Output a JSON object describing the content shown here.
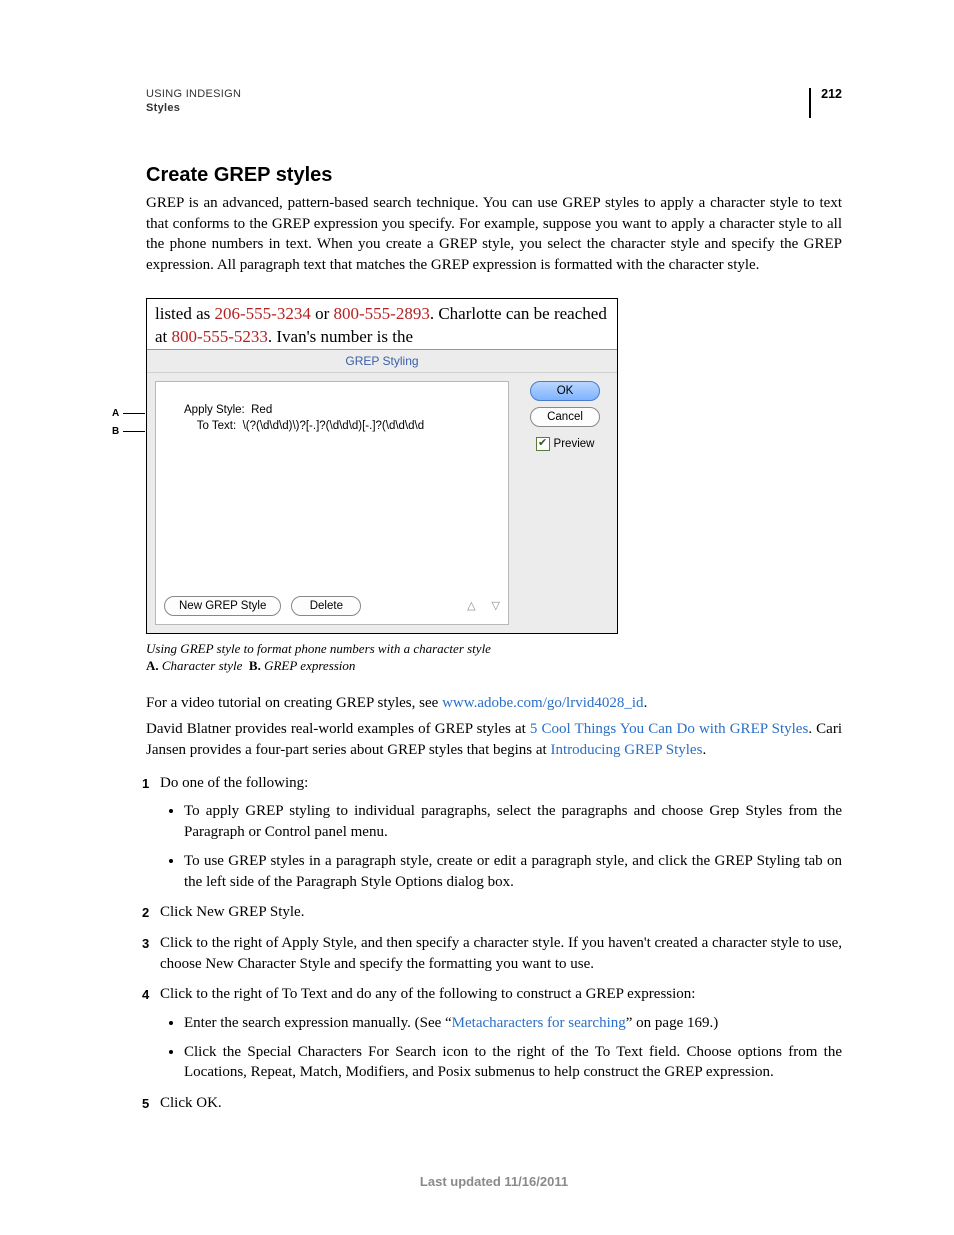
{
  "header": {
    "product": "USING INDESIGN",
    "section": "Styles",
    "page_number": "212"
  },
  "title": "Create GREP styles",
  "intro": "GREP is an advanced, pattern-based search technique. You can use GREP styles to apply a character style to text that conforms to the GREP expression you specify. For example, suppose you want to apply a character style to all the phone numbers in text. When you create a GREP style, you select the character style and specify the GREP expression. All paragraph text that matches the GREP expression is formatted with the character style.",
  "figure": {
    "sample": {
      "prefix1": "listed as ",
      "phone1": "206-555-3234",
      "mid1": " or ",
      "phone2": "800-555-2893",
      "suffix1": ". Charlotte can be reached at ",
      "phone3": "800-555-5233",
      "suffix2": ". Ivan's number is the"
    },
    "dialog_title": "GREP Styling",
    "apply_style_label": "Apply Style:",
    "apply_style_value": "Red",
    "to_text_label": "To Text:",
    "to_text_value": "\\(?(\\d\\d\\d)\\)?[-.]?(\\d\\d\\d)[-.]?(\\d\\d\\d\\d",
    "ok": "OK",
    "cancel": "Cancel",
    "preview": "Preview",
    "new_grep_style": "New GREP Style",
    "delete": "Delete",
    "callout_a": "A",
    "callout_b": "B",
    "caption_main": "Using GREP style to format phone numbers with a character style",
    "caption_a_label": "A.",
    "caption_a_text": "Character style",
    "caption_b_label": "B.",
    "caption_b_text": "GREP expression"
  },
  "para2": {
    "prefix": "For a video tutorial on creating GREP styles, see ",
    "link": "www.adobe.com/go/lrvid4028_id",
    "suffix": "."
  },
  "para3": {
    "p1": "David Blatner provides real-world examples of GREP styles at ",
    "link1": "5 Cool Things You Can Do with GREP Styles",
    "p2": ". Cari Jansen provides a four-part series about GREP styles that begins at ",
    "link2": "Introducing GREP Styles",
    "p3": "."
  },
  "steps": {
    "s1": "Do one of the following:",
    "s1_b1": "To apply GREP styling to individual paragraphs, select the paragraphs and choose Grep Styles from the Paragraph or Control panel menu.",
    "s1_b2": "To use GREP styles in a paragraph style, create or edit a paragraph style, and click the GREP Styling tab on the left side of the Paragraph Style Options dialog box.",
    "s2": "Click New GREP Style.",
    "s3": "Click to the right of Apply Style, and then specify a character style. If you haven't created a character style to use, choose New Character Style and specify the formatting you want to use.",
    "s4": "Click to the right of To Text and do any of the following to construct a GREP expression:",
    "s4_b1a": "Enter the search expression manually. (See “",
    "s4_b1_link": "Metacharacters for searching",
    "s4_b1b": "” on page 169.)",
    "s4_b2": "Click the Special Characters For Search icon to the right of the To Text field. Choose options from the Locations, Repeat, Match, Modifiers, and Posix submenus to help construct the GREP expression.",
    "s5": "Click OK."
  },
  "footer": "Last updated 11/16/2011"
}
